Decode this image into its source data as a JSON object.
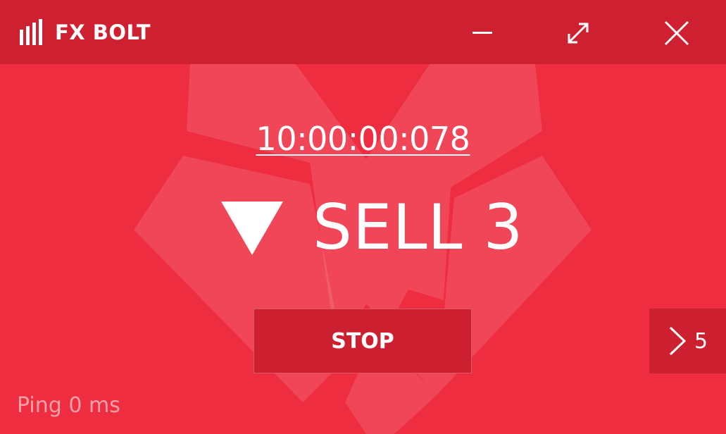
{
  "app": {
    "name": "FX BOLT",
    "logo_icon": "signal-bars-icon"
  },
  "window_controls": {
    "minimize_icon": "minimize-icon",
    "maximize_icon": "expand-icon",
    "close_icon": "close-icon"
  },
  "signal": {
    "time": "10:00:00:078",
    "direction_icon": "triangle-down-icon",
    "label": "SELL 3"
  },
  "actions": {
    "stop_label": "STOP",
    "next_icon": "chevron-right-icon",
    "next_count": "5"
  },
  "status": {
    "ping_text": "Ping 0 ms"
  },
  "colors": {
    "background": "#ee2d40",
    "titlebar": "#ce2030",
    "button": "#cc2030",
    "text": "#ffffff"
  }
}
